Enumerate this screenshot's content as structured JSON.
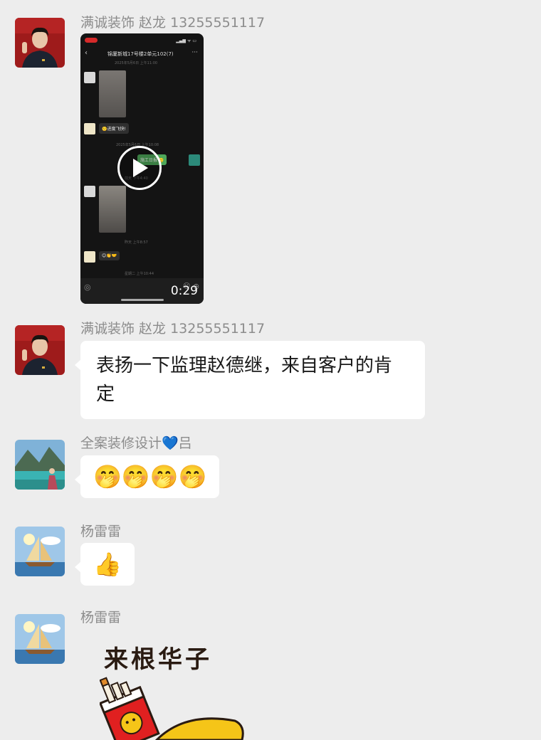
{
  "messages": [
    {
      "sender": "满诚装饰 赵龙 13255551117",
      "type": "video",
      "duration": "0:29",
      "video": {
        "chat_title": "锦厦新城17号楼2单元102(7)",
        "time1": "2025年5月6日 上午11:00",
        "time2": "2025年5月6日 上午10:08",
        "time3": "前天 下午4:40",
        "time4": "昨天 上午8:57",
        "time5": "星期二 上午10:44",
        "bubble1": "🙂进度飞快!",
        "bubble2": "施工日报 🙂",
        "bubble3": "😊👏🤝"
      }
    },
    {
      "sender": "满诚装饰 赵龙 13255551117",
      "type": "text",
      "text": "表扬一下监理赵德继，来自客户的肯定"
    },
    {
      "sender": "全案装修设计💙吕",
      "type": "emoji",
      "text": "🤭🤭🤭🤭"
    },
    {
      "sender": "杨雷雷",
      "type": "emoji",
      "text": "👍"
    },
    {
      "sender": "杨雷雷",
      "type": "sticker",
      "text": "来根华子"
    }
  ],
  "colors": {
    "background": "#ededed",
    "bubble": "#ffffff",
    "sender_text": "#8c8c8c",
    "message_text": "#191919"
  },
  "icons": [
    "play-icon",
    "back-chevron-icon",
    "more-icon",
    "voice-icon",
    "emoji-icon",
    "plus-icon"
  ]
}
